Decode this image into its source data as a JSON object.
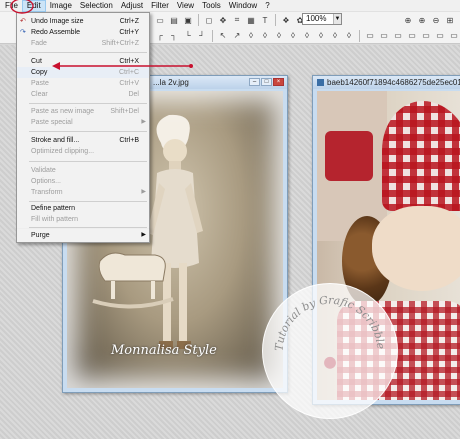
{
  "menubar": {
    "items": [
      "File",
      "Edit",
      "Image",
      "Selection",
      "Adjust",
      "Filter",
      "View",
      "Tools",
      "Window",
      "?"
    ]
  },
  "toolbar": {
    "zoom_value": "100%"
  },
  "edit_menu": {
    "items": [
      {
        "label": "Undo Image size",
        "shortcut": "Ctrl+Z",
        "disabled": false
      },
      {
        "label": "Redo Assemble",
        "shortcut": "Ctrl+Y",
        "disabled": false
      },
      {
        "label": "Fade",
        "shortcut": "Shift+Ctrl+Z",
        "disabled": true
      },
      {
        "label": "Cut",
        "shortcut": "Ctrl+X",
        "disabled": false
      },
      {
        "label": "Copy",
        "shortcut": "Ctrl+C",
        "disabled": false
      },
      {
        "label": "Paste",
        "shortcut": "Ctrl+V",
        "disabled": true
      },
      {
        "label": "Clear",
        "shortcut": "Del",
        "disabled": true
      },
      {
        "label": "Paste as new image",
        "shortcut": "Shift+Del",
        "disabled": true
      },
      {
        "label": "Paste special",
        "shortcut": "",
        "disabled": true
      },
      {
        "label": "Stroke and fill...",
        "shortcut": "Ctrl+B",
        "disabled": false
      },
      {
        "label": "Optimized clipping...",
        "shortcut": "",
        "disabled": true
      },
      {
        "label": "Validate",
        "shortcut": "",
        "disabled": true
      },
      {
        "label": "Options...",
        "shortcut": "",
        "disabled": true
      },
      {
        "label": "Transform",
        "shortcut": "",
        "disabled": true
      },
      {
        "label": "Define pattern",
        "shortcut": "",
        "disabled": false
      },
      {
        "label": "Fill with pattern",
        "shortcut": "",
        "disabled": true
      },
      {
        "label": "Purge",
        "shortcut": "",
        "disabled": false
      }
    ]
  },
  "windows": {
    "left_title": "...la 2v.jpg",
    "right_title": "baeb14260f71894c4686275de25ec01",
    "left_watermark": "Monnalisa Style",
    "stamp_text": "Tutorial by Grafic Scribbles"
  },
  "colors": {
    "annotation_red": "#c8102e"
  }
}
